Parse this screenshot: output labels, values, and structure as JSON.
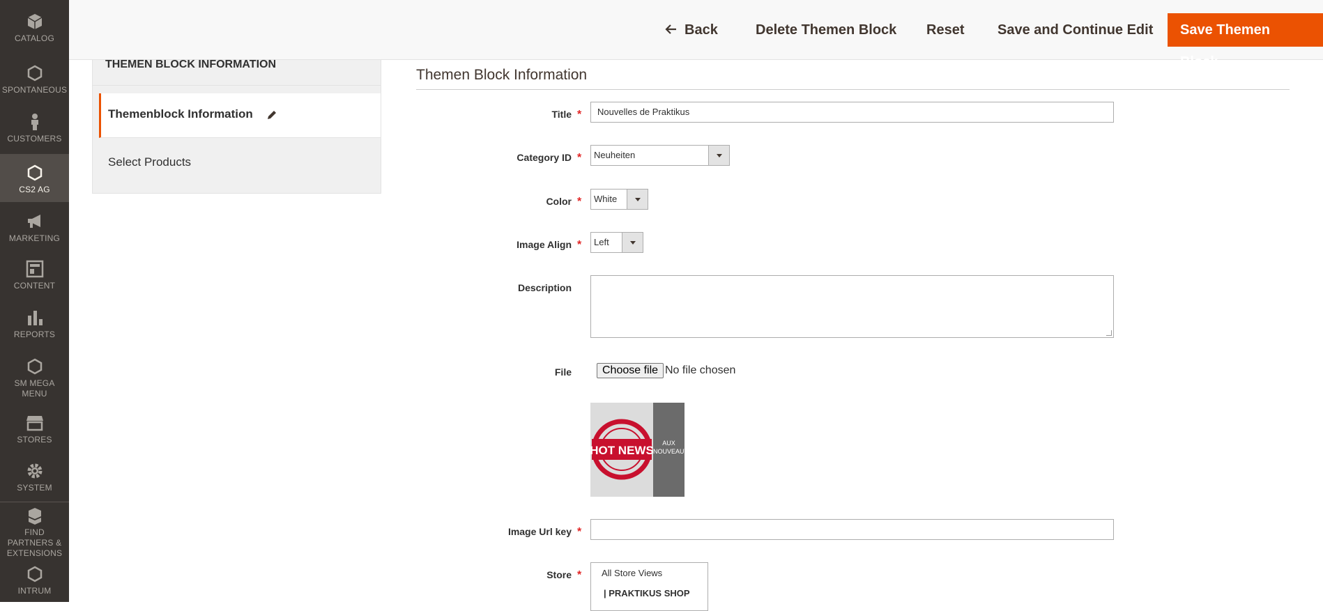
{
  "nav": {
    "items": [
      {
        "label": "CATALOG",
        "icon": "cube-icon"
      },
      {
        "label": "SPONTANEOUS",
        "icon": "hexagon-icon"
      },
      {
        "label": "CUSTOMERS",
        "icon": "person-icon"
      },
      {
        "label": "CS2 AG",
        "icon": "hexagon-icon"
      },
      {
        "label": "MARKETING",
        "icon": "megaphone-icon"
      },
      {
        "label": "CONTENT",
        "icon": "layout-icon"
      },
      {
        "label": "REPORTS",
        "icon": "bar-chart-icon"
      },
      {
        "label": "SM MEGA MENU",
        "icon": "hexagon-icon"
      },
      {
        "label": "STORES",
        "icon": "store-icon"
      },
      {
        "label": "SYSTEM",
        "icon": "gear-icon"
      },
      {
        "label": "FIND PARTNERS & EXTENSIONS",
        "icon": "boxes-icon"
      },
      {
        "label": "INTRUM",
        "icon": "hexagon-icon"
      }
    ]
  },
  "header": {
    "back_label": "Back",
    "delete_label": "Delete Themen Block",
    "reset_label": "Reset",
    "save_continue_label": "Save and Continue Edit",
    "save_label": "Save Themen Block",
    "accent_color": "#eb5202"
  },
  "side": {
    "title": "THEMEN BLOCK INFORMATION",
    "tabs": [
      {
        "label": "Themenblock Information"
      },
      {
        "label": "Select Products"
      }
    ]
  },
  "form": {
    "section_title": "Themen Block Information",
    "title_label": "Title",
    "title_value": "Nouvelles de Praktikus",
    "category_label": "Category ID",
    "category_value": "Neuheiten",
    "color_label": "Color",
    "color_value": "White",
    "align_label": "Image Align",
    "align_value": "Left",
    "description_label": "Description",
    "file_label": "File",
    "file_button": "Choose file",
    "file_status": "No file chosen",
    "preview_text_left": "HOT NEWS",
    "preview_text_right": "AUX NOUVEAUTÉS",
    "url_key_label": "Image Url key",
    "url_key_value": "",
    "store_label": "Store",
    "store_options": [
      "All Store Views",
      "| PRAKTIKUS SHOP"
    ]
  }
}
